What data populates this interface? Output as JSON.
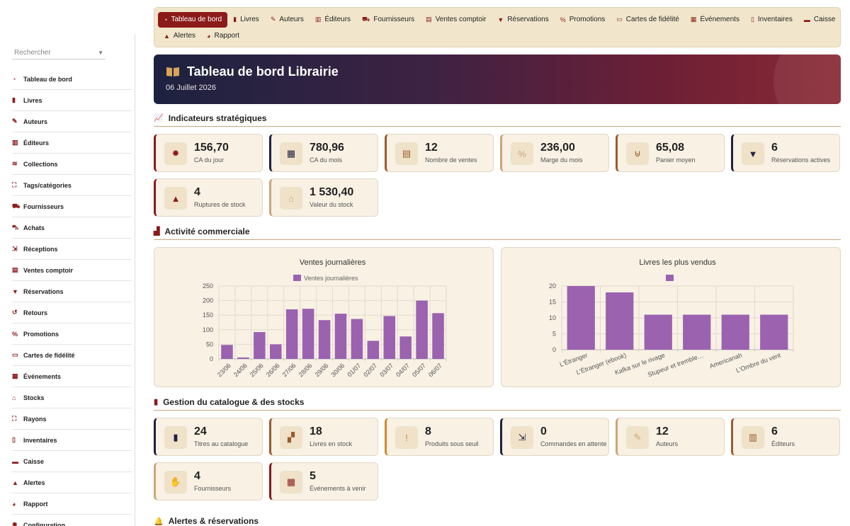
{
  "sidebar": {
    "search_placeholder": "Rechercher",
    "items": [
      {
        "label": "Tableau de bord",
        "icon": "gauge-icon"
      },
      {
        "label": "Livres",
        "icon": "book-icon"
      },
      {
        "label": "Auteurs",
        "icon": "feather-icon"
      },
      {
        "label": "Éditeurs",
        "icon": "building-icon"
      },
      {
        "label": "Collections",
        "icon": "layers-icon"
      },
      {
        "label": "Tags/catégories",
        "icon": "sitemap-icon"
      },
      {
        "label": "Fournisseurs",
        "icon": "truck-icon"
      },
      {
        "label": "Achats",
        "icon": "cart-icon"
      },
      {
        "label": "Réceptions",
        "icon": "dolly-icon"
      },
      {
        "label": "Ventes comptoir",
        "icon": "cash-register-icon"
      },
      {
        "label": "Réservations",
        "icon": "bookmark-icon"
      },
      {
        "label": "Retours",
        "icon": "undo-icon"
      },
      {
        "label": "Promotions",
        "icon": "percent-icon"
      },
      {
        "label": "Cartes de fidélité",
        "icon": "id-card-icon"
      },
      {
        "label": "Événements",
        "icon": "calendar-icon"
      },
      {
        "label": "Stocks",
        "icon": "warehouse-icon"
      },
      {
        "label": "Rayons",
        "icon": "sitemap-icon"
      },
      {
        "label": "Inventaires",
        "icon": "clipboard-icon"
      },
      {
        "label": "Caisse",
        "icon": "money-icon"
      },
      {
        "label": "Alertes",
        "icon": "warning-icon"
      },
      {
        "label": "Rapport",
        "icon": "pie-icon"
      },
      {
        "label": "Configuration",
        "icon": "gear-icon"
      }
    ]
  },
  "topnav": {
    "row1": [
      {
        "label": "Tableau de bord",
        "icon": "gauge-icon",
        "active": true
      },
      {
        "label": "Livres",
        "icon": "book-icon"
      },
      {
        "label": "Auteurs",
        "icon": "feather-icon"
      },
      {
        "label": "Éditeurs",
        "icon": "building-icon"
      },
      {
        "label": "Fournisseurs",
        "icon": "truck-icon"
      },
      {
        "label": "Ventes comptoir",
        "icon": "cash-register-icon"
      },
      {
        "label": "Réservations",
        "icon": "bookmark-icon"
      },
      {
        "label": "Promotions",
        "icon": "percent-icon"
      },
      {
        "label": "Cartes de fidélité",
        "icon": "id-card-icon"
      },
      {
        "label": "Événements",
        "icon": "calendar-icon"
      },
      {
        "label": "Inventaires",
        "icon": "clipboard-icon"
      },
      {
        "label": "Caisse",
        "icon": "money-icon"
      }
    ],
    "row2": [
      {
        "label": "Alertes",
        "icon": "warning-icon"
      },
      {
        "label": "Rapport",
        "icon": "pie-icon"
      }
    ]
  },
  "hero": {
    "title": "Tableau de bord Librairie",
    "date": "06 Juillet 2026"
  },
  "sections": {
    "strategic": "Indicateurs stratégiques",
    "commercial": "Activité commerciale",
    "catalogue": "Gestion du catalogue & des stocks",
    "alerts": "Alertes & réservations"
  },
  "strategic_cards": [
    {
      "value": "156,70",
      "label": "CA du jour",
      "icon": "gear-icon",
      "accent": "#8b1a1a"
    },
    {
      "value": "780,96",
      "label": "CA du mois",
      "icon": "calendar-icon",
      "accent": "#1d2240"
    },
    {
      "value": "12",
      "label": "Nombre de ventes",
      "icon": "receipt-icon",
      "accent": "#9c5a2e"
    },
    {
      "value": "236,00",
      "label": "Marge du mois",
      "icon": "percent-icon",
      "accent": "#c9a77a"
    },
    {
      "value": "65,08",
      "label": "Panier moyen",
      "icon": "basket-icon",
      "accent": "#9c5a2e"
    },
    {
      "value": "6",
      "label": "Réservations actives",
      "icon": "bookmark-icon",
      "accent": "#1d2240"
    },
    {
      "value": "4",
      "label": "Ruptures de stock",
      "icon": "warning-icon",
      "accent": "#8b1a1a"
    },
    {
      "value": "1 530,40",
      "label": "Valeur du stock",
      "icon": "warehouse-icon",
      "accent": "#c9a77a"
    }
  ],
  "catalogue_cards": [
    {
      "value": "24",
      "label": "Titres au catalogue",
      "icon": "book-icon",
      "accent": "#1d2240"
    },
    {
      "value": "18",
      "label": "Livres en stock",
      "icon": "boxes-icon",
      "accent": "#9c5a2e"
    },
    {
      "value": "8",
      "label": "Produits sous seuil",
      "icon": "exclamation-icon",
      "accent": "#d48a2a"
    },
    {
      "value": "0",
      "label": "Commandes en attente",
      "icon": "dolly-icon",
      "accent": "#1d2240"
    },
    {
      "value": "12",
      "label": "Auteurs",
      "icon": "feather-icon",
      "accent": "#c9a77a"
    },
    {
      "value": "6",
      "label": "Éditeurs",
      "icon": "building-icon",
      "accent": "#9c5a2e"
    },
    {
      "value": "4",
      "label": "Fournisseurs",
      "icon": "handshake-icon",
      "accent": "#c9a77a"
    },
    {
      "value": "5",
      "label": "Événements à venir",
      "icon": "calendar-icon",
      "accent": "#8b1a1a"
    }
  ],
  "colors": {
    "brand": "#8b1a1a",
    "bar": "#9b62b0",
    "navy": "#1d2240"
  },
  "chart_data": [
    {
      "type": "bar",
      "title": "Ventes journalières",
      "categories": [
        "23/06",
        "24/06",
        "25/06",
        "26/06",
        "27/06",
        "28/06",
        "29/06",
        "30/06",
        "01/07",
        "02/07",
        "03/07",
        "04/07",
        "05/07",
        "06/07"
      ],
      "series": [
        {
          "name": "Ventes journalières",
          "values": [
            48,
            5,
            92,
            50,
            170,
            172,
            133,
            155,
            137,
            62,
            147,
            77,
            200,
            157
          ]
        }
      ],
      "ylim": [
        0,
        250
      ],
      "yticks": [
        0,
        50,
        100,
        150,
        200,
        250
      ],
      "grid": true,
      "legend": "top"
    },
    {
      "type": "bar",
      "title": "Livres les plus vendus",
      "categories": [
        "L'Étranger",
        "L'Étranger (ebook)",
        "Kafka sur le rivage",
        "Stupeur et tremble…",
        "Americanah",
        "L'Ombre du vent"
      ],
      "series": [
        {
          "name": "",
          "values": [
            20,
            18,
            11,
            11,
            11,
            11
          ]
        }
      ],
      "ylim": [
        0,
        20
      ],
      "yticks": [
        0,
        5,
        10,
        15,
        20
      ],
      "grid": true,
      "legend": "top"
    }
  ]
}
